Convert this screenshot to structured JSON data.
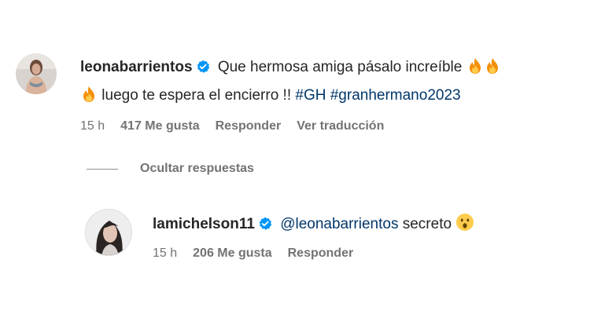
{
  "comments": [
    {
      "username": "leonabarrientos",
      "text_line1": "Que hermosa amiga pásalo increíble",
      "text_line2": "luego te espera el encierro !!",
      "hashtag1": "#GH",
      "hashtag2": "#granhermano2023",
      "time": "15 h",
      "likes": "417 Me gusta",
      "reply_label": "Responder",
      "translate_label": "Ver traducción"
    }
  ],
  "hide_replies_label": "Ocultar respuestas",
  "reply": {
    "username": "lamichelson11",
    "mention": "@leonabarrientos",
    "text": "secreto",
    "time": "15 h",
    "likes": "206 Me gusta",
    "reply_label": "Responder"
  },
  "icons": {
    "verified": "verified-badge-icon",
    "fire": "fire-emoji-icon",
    "surprised": "surprised-face-emoji-icon"
  },
  "colors": {
    "verified": "#0095f6",
    "hashtag": "#00376b",
    "meta": "#737373"
  }
}
